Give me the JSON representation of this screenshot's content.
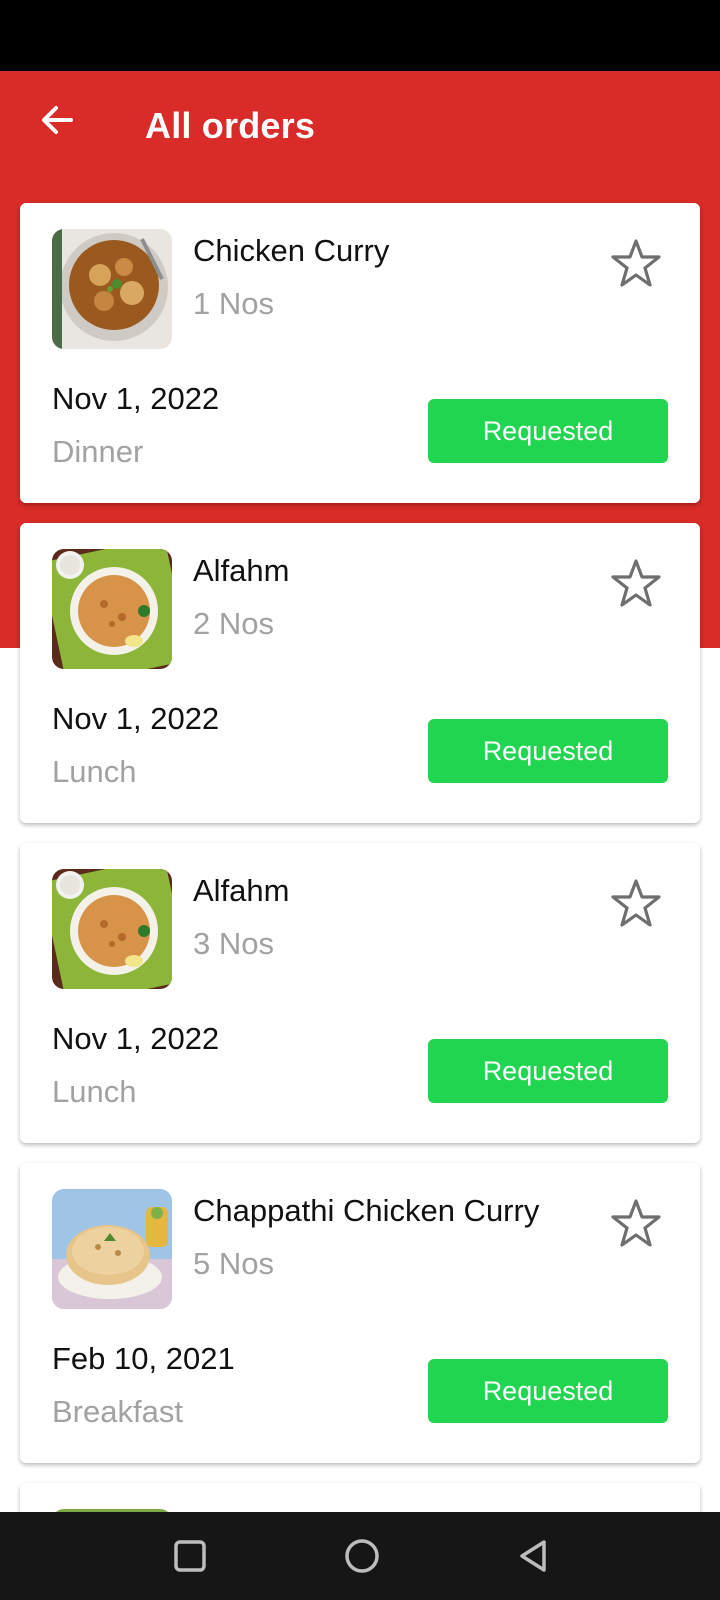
{
  "header": {
    "title": "All orders"
  },
  "icons": {
    "back": "arrow-left-icon",
    "favorite": "star-outline-icon",
    "nav_recents": "square-icon",
    "nav_home": "circle-icon",
    "nav_back": "triangle-back-icon"
  },
  "colors": {
    "header": "#d92b27",
    "status_button": "#22d551"
  },
  "orders": [
    {
      "name": "Chicken Curry",
      "quantity": "1 Nos",
      "date": "Nov 1, 2022",
      "meal": "Dinner",
      "status": "Requested",
      "image": "chicken-curry-photo"
    },
    {
      "name": "Alfahm",
      "quantity": "2 Nos",
      "date": "Nov 1, 2022",
      "meal": "Lunch",
      "status": "Requested",
      "image": "biryani-plate-photo"
    },
    {
      "name": "Alfahm",
      "quantity": "3 Nos",
      "date": "Nov 1, 2022",
      "meal": "Lunch",
      "status": "Requested",
      "image": "biryani-plate-photo"
    },
    {
      "name": "Chappathi Chicken Curry",
      "quantity": "5 Nos",
      "date": "Feb 10, 2021",
      "meal": "Breakfast",
      "status": "Requested",
      "image": "chappathi-photo"
    }
  ]
}
